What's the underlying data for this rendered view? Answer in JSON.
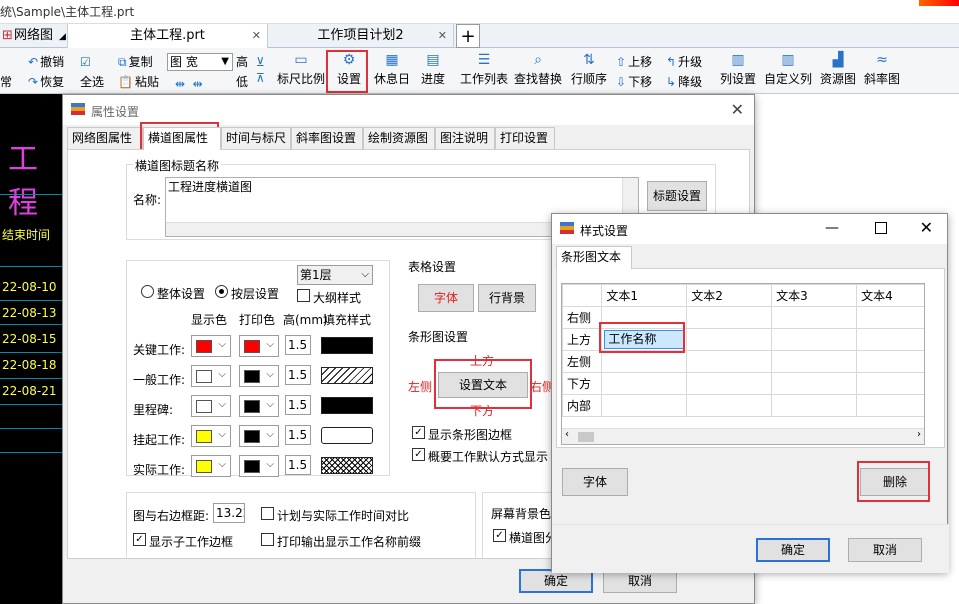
{
  "window": {
    "title": "统\\Sample\\主体工程.prt"
  },
  "tabs": [
    {
      "label": "网络图"
    },
    {
      "label": "主体工程.prt"
    },
    {
      "label": "工作项目计划2"
    },
    {
      "label": "+"
    }
  ],
  "ribbon": {
    "left_cut": "常",
    "undo": "撤销",
    "redo": "恢复",
    "select_all": "全选",
    "copy": "复制",
    "paste": "粘贴",
    "dropdown": "图 宽",
    "high": "高",
    "low": "低",
    "buttons": [
      "标尺比例",
      "设置",
      "休息日",
      "进度",
      "工作列表",
      "查找替换",
      "行顺序",
      "上移",
      "下移",
      "升级",
      "降级",
      "列设置",
      "自定义列",
      "资源图",
      "斜率图"
    ]
  },
  "left_panel": {
    "heading": "工程",
    "col_label": "结束时间",
    "dates": [
      "22-08-10",
      "22-08-13",
      "22-08-15",
      "22-08-18",
      "22-08-21"
    ]
  },
  "prop_dialog": {
    "title": "属性设置",
    "tabs": [
      "网络图属性",
      "横道图属性",
      "时间与标尺",
      "斜率图设置",
      "绘制资源图",
      "图注说明",
      "打印设置"
    ],
    "title_group": "横道图标题名称",
    "name_label": "名称:",
    "name_value": "工程进度横道图",
    "title_settings_btn": "标题设置",
    "whole_setting": "整体设置",
    "by_layer": "按层设置",
    "layer": "第1层",
    "outline_style": "大纲样式",
    "col_display": "显示色",
    "col_print": "打印色",
    "col_height": "高(mm)",
    "col_fill": "填充样式",
    "rows": [
      {
        "name": "关键工作:",
        "display": "#ff0000",
        "print": "#ff0000",
        "height": "1.5"
      },
      {
        "name": "一般工作:",
        "display": "#ffffff",
        "print": "#000000",
        "height": "1.5"
      },
      {
        "name": "里程碑:",
        "display": "#ffffff",
        "print": "#000000",
        "height": "1.5"
      },
      {
        "name": "挂起工作:",
        "display": "#ffff00",
        "print": "#000000",
        "height": "1.5"
      },
      {
        "name": "实际工作:",
        "display": "#ffff00",
        "print": "#000000",
        "height": "1.5"
      }
    ],
    "table_settings": "表格设置",
    "font_btn": "字体",
    "row_bg_btn": "行背景",
    "bar_settings": "条形图设置",
    "top": "上方",
    "left": "左侧",
    "right": "右侧",
    "bottom": "下方",
    "set_text_btn": "设置文本",
    "show_bar_border": "显示条形图边框",
    "summary_default": "概要工作默认方式显示",
    "margin_label": "图与右边框距:",
    "margin_value": "13.22",
    "plan_vs_actual": "计划与实际工作时间对比",
    "show_sub_border": "显示子工作边框",
    "print_prefix": "打印输出显示工作名称前缀",
    "screen_bg": "屏幕背景色",
    "gantt_split": "横道图分",
    "ok": "确定",
    "cancel": "取消"
  },
  "style_dialog": {
    "title": "样式设置",
    "tab": "条形图文本",
    "headers": [
      "",
      "文本1",
      "文本2",
      "文本3",
      "文本4"
    ],
    "row_labels": [
      "右侧",
      "上方",
      "左侧",
      "下方",
      "内部"
    ],
    "selected_cell": "工作名称",
    "font_btn": "字体",
    "delete_btn": "删除",
    "ok": "确定",
    "cancel": "取消"
  }
}
